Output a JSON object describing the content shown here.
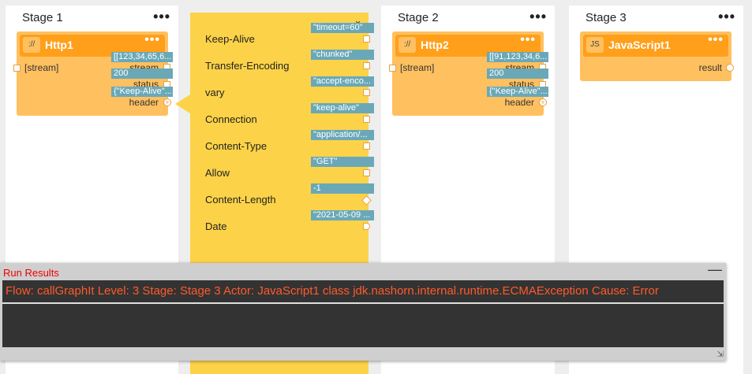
{
  "stages": [
    {
      "title": "Stage 1",
      "menu": "•••"
    },
    {
      "title": "Stage 2",
      "menu": "•••"
    },
    {
      "title": "Stage 3",
      "menu": "•••"
    }
  ],
  "actors": {
    "http1": {
      "icon": "://",
      "name": "Http1",
      "menu": "•••",
      "input": "[stream]",
      "out_stream_value": "[[123,34,65,6...",
      "out_stream_label": "stream",
      "out_status_value": "200",
      "out_status_label": "status",
      "out_header_value": "{\"Keep-Alive\"...",
      "out_header_label": "header"
    },
    "http2": {
      "icon": "://",
      "name": "Http2",
      "menu": "•••",
      "input": "[stream]",
      "out_stream_value": "[[91,123,34,6...",
      "out_stream_label": "stream",
      "out_status_value": "200",
      "out_status_label": "status",
      "out_header_value": "{\"Keep-Alive\"...",
      "out_header_label": "header"
    },
    "js1": {
      "icon": "JS",
      "name": "JavaScript1",
      "menu": "•••",
      "output": "result"
    }
  },
  "header_popup": {
    "close": "⌄",
    "rows": [
      {
        "name": "Keep-Alive",
        "value": "\"timeout=60\""
      },
      {
        "name": "Transfer-Encoding",
        "value": "\"chunked\""
      },
      {
        "name": "vary",
        "value": "\"accept-enco..."
      },
      {
        "name": "Connection",
        "value": "\"keep-alive\""
      },
      {
        "name": "Content-Type",
        "value": "\"application/..."
      },
      {
        "name": "Allow",
        "value": "\"GET\""
      },
      {
        "name": "Content-Length",
        "value": "-1"
      },
      {
        "name": "Date",
        "value": "\"2021-05-09 ..."
      }
    ]
  },
  "run_results": {
    "title": "Run Results",
    "minimize": "—",
    "message": "Flow: callGraphIt Level: 3 Stage: Stage 3 Actor: JavaScript1 class jdk.nashorn.internal.runtime.ECMAException Cause: Error",
    "resize": "⇲"
  }
}
